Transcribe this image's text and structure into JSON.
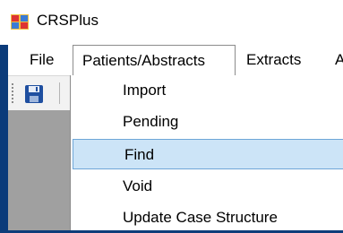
{
  "window": {
    "title": "CRSPlus"
  },
  "menubar": {
    "items": [
      {
        "label": "File"
      },
      {
        "label": "Patients/Abstracts",
        "state": "open"
      },
      {
        "label": "Extracts"
      },
      {
        "label": "A"
      }
    ]
  },
  "toolbar": {
    "buttons": [
      {
        "icon": "save-icon"
      }
    ]
  },
  "dropdown": {
    "items": [
      {
        "label": "Import"
      },
      {
        "label": "Pending"
      },
      {
        "label": "Find",
        "selected": true
      },
      {
        "label": "Void"
      },
      {
        "label": "Update Case Structure"
      }
    ]
  },
  "colors": {
    "desktop": "#0b3b7a",
    "selection_bg": "#cce4f7",
    "selection_border": "#6ea6d8",
    "panel_gray": "#a0a0a0"
  }
}
